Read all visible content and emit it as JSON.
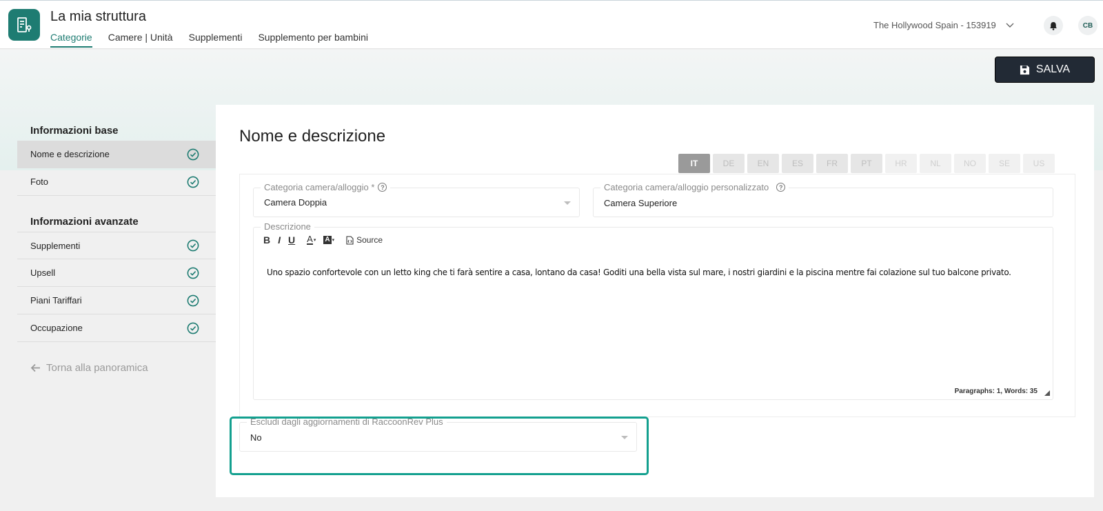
{
  "header": {
    "title": "La mia struttura",
    "tabs": [
      "Categorie",
      "Camere | Unità",
      "Supplementi",
      "Supplemento per bambini"
    ],
    "property": "The Hollywood Spain - 153919",
    "avatar": "CB"
  },
  "toolbar": {
    "save_label": "SALVA"
  },
  "sidebar": {
    "section1": "Informazioni base",
    "items1": [
      "Nome e descrizione",
      "Foto"
    ],
    "section2": "Informazioni avanzate",
    "items2": [
      "Supplementi",
      "Upsell",
      "Piani Tariffari",
      "Occupazione"
    ],
    "back": "Torna alla panoramica"
  },
  "main": {
    "title": "Nome e descrizione",
    "languages": [
      "IT",
      "DE",
      "EN",
      "ES",
      "FR",
      "PT",
      "HR",
      "NL",
      "NO",
      "SE",
      "US"
    ],
    "category": {
      "label": "Categoria camera/alloggio *",
      "value": "Camera Doppia"
    },
    "custom_category": {
      "label": "Categoria camera/alloggio personalizzato",
      "value": "Camera Superiore"
    },
    "description": {
      "label": "Descrizione",
      "source_label": "Source",
      "text": "Uno spazio confortevole con un letto king che ti farà sentire a casa, lontano da casa! Goditi una bella vista sul mare, i nostri giardini e la piscina mentre fai colazione sul tuo balcone privato.",
      "count": "Paragraphs: 1, Words: 35"
    },
    "exclude": {
      "label": "Escludi dagli aggiornamenti di RaccoonRev Plus",
      "value": "No"
    }
  },
  "colors": {
    "accent": "#1e7c72",
    "highlight": "#13a08f",
    "save_bg": "#222a35"
  }
}
